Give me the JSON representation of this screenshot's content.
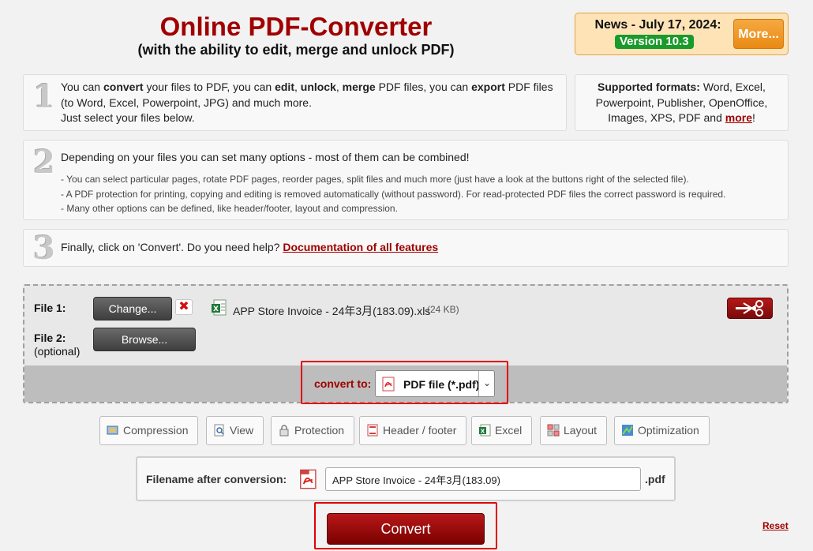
{
  "header": {
    "title": "Online PDF-Converter",
    "subtitle": "(with the ability to edit, merge and unlock PDF)"
  },
  "news": {
    "text": "News - July 17, 2024:",
    "version": "Version 10.3",
    "more_label": "More..."
  },
  "step1": {
    "number": "1",
    "t1": "You can ",
    "b1": "convert",
    "t2": " your files to PDF, you can ",
    "b2": "edit",
    "t3": ", ",
    "b3": "unlock",
    "t4": ", ",
    "b4": "merge",
    "t5": " PDF files, you can ",
    "b5": "export",
    "t6": " PDF files",
    "line2": "(to Word, Excel, Powerpoint, JPG) and much more.",
    "line3": "Just select your files below."
  },
  "formats": {
    "label": "Supported formats:",
    "line1": " Word, Excel,",
    "line2": "Powerpoint, Publisher, OpenOffice,",
    "line3": "Images, XPS, PDF and ",
    "more_link": "more",
    "end": "!"
  },
  "step2": {
    "number": "2",
    "main": "Depending on your files you can set many options - most of them can be combined!",
    "bullets": [
      "- You can select particular pages, rotate PDF pages, reorder pages, split files and much more (just have a look at the buttons right of the selected file).",
      "- A PDF protection for printing, copying and editing is removed automatically (without password). For read-protected PDF files the correct password is required.",
      "- Many other options can be defined, like header/footer, layout and compression."
    ]
  },
  "step3": {
    "number": "3",
    "text": "Finally, click on 'Convert'. Do you need help? ",
    "link": "Documentation of all features"
  },
  "files": {
    "file1_label": "File 1:",
    "change_label": "Change...",
    "remove_symbol": "✖",
    "file1_name": "APP Store Invoice - 24年3月(183.09).xls",
    "file1_size": "(24 KB)",
    "file2_label": "File 2:",
    "file2_optional": "(optional)",
    "browse_label": "Browse..."
  },
  "convert_to": {
    "label": "convert to:",
    "selected": "PDF file (*.pdf)"
  },
  "options": [
    {
      "label": "Compression",
      "icon": "compression-icon"
    },
    {
      "label": "View",
      "icon": "view-icon"
    },
    {
      "label": "Protection",
      "icon": "lock-icon"
    },
    {
      "label": "Header / footer",
      "icon": "header-footer-icon"
    },
    {
      "label": "Excel",
      "icon": "excel-icon"
    },
    {
      "label": "Layout",
      "icon": "layout-icon"
    },
    {
      "label": "Optimization",
      "icon": "optimization-icon"
    }
  ],
  "filename": {
    "label": "Filename after conversion:",
    "value": "APP Store Invoice - 24年3月(183.09)",
    "extension": ".pdf"
  },
  "actions": {
    "convert_label": "Convert",
    "reset_label": "Reset"
  },
  "colors": {
    "brand_red": "#a00000",
    "news_orange": "#e98a14",
    "version_green": "#1a9a2a",
    "highlight_red": "#e00000"
  }
}
